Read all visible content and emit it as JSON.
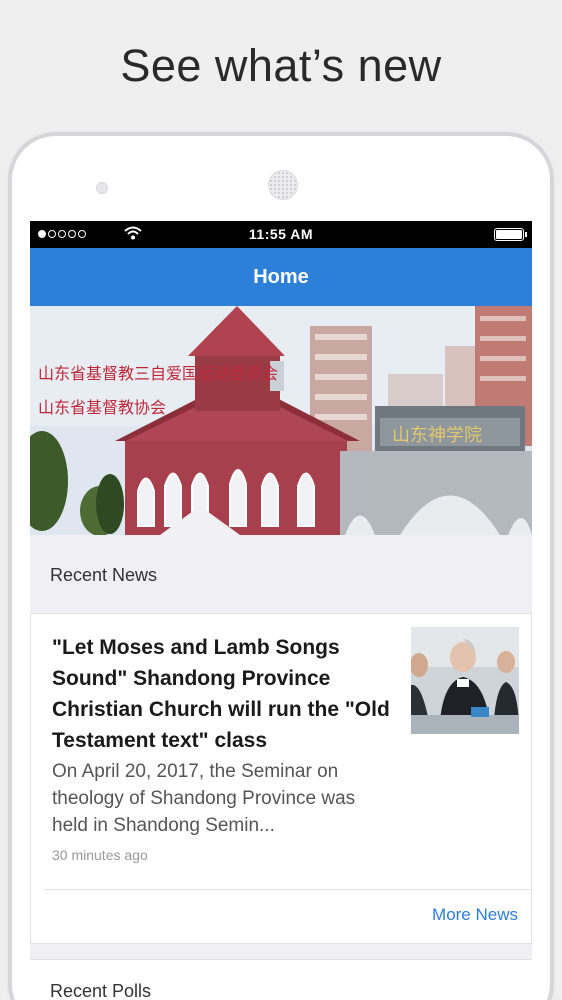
{
  "promo": {
    "headline": "See what’s new"
  },
  "status_bar": {
    "signal_icon": "signal-dots-icon",
    "wifi_icon": "wifi-icon",
    "time": "11:55 AM",
    "battery_icon": "battery-icon"
  },
  "nav": {
    "title": "Home"
  },
  "hero": {
    "banner_line_1": "山东省基督教三自爱国运动委员会",
    "banner_line_2": "山东省基督教协会",
    "gate_sign": "山东神学院"
  },
  "recent_news": {
    "section_title": "Recent News",
    "item": {
      "title": "\"Let Moses and Lamb Songs Sound\" Shandong Province Christian Church will run the \"Old Testament text\" class",
      "summary": "On April 20, 2017, the Seminar on theology of Shandong Province was held in Shandong Semin...",
      "time": "30 minutes ago"
    },
    "more_label": "More News"
  },
  "recent_polls": {
    "section_title": "Recent Polls"
  },
  "colors": {
    "accent": "#2d7fd8",
    "background": "#efeff4"
  }
}
